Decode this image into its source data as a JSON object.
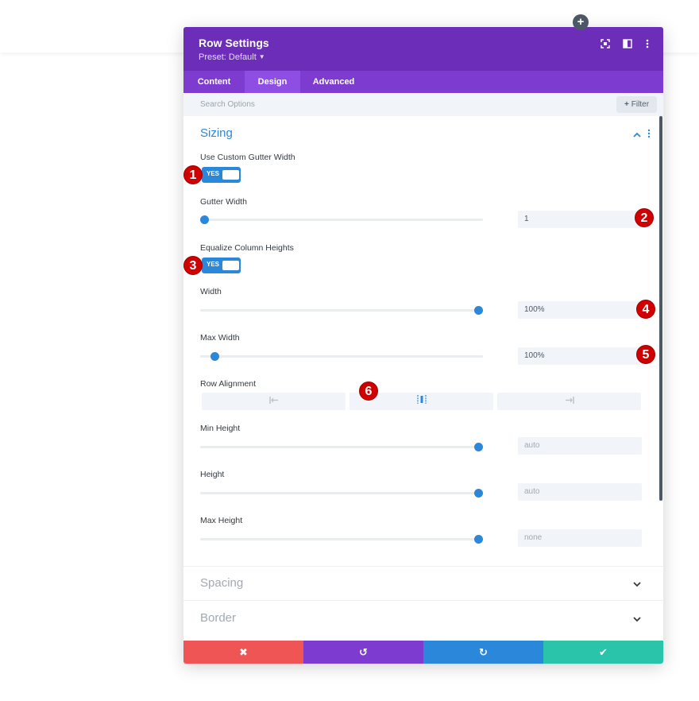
{
  "modal": {
    "title": "Row Settings",
    "preset": "Preset: Default",
    "header_icons": [
      "focus-icon",
      "sidebar-layout-icon",
      "kebab-menu-icon"
    ]
  },
  "tabs": [
    {
      "label": "Content",
      "active": false
    },
    {
      "label": "Design",
      "active": true
    },
    {
      "label": "Advanced",
      "active": false
    }
  ],
  "search": {
    "placeholder": "Search Options",
    "filter_label": "Filter"
  },
  "sections": {
    "sizing": {
      "title": "Sizing",
      "custom_gutter": {
        "label": "Use Custom Gutter Width",
        "toggle": "YES"
      },
      "gutter_width": {
        "label": "Gutter Width",
        "value": "1",
        "slider": 0.02
      },
      "equalize": {
        "label": "Equalize Column Heights",
        "toggle": "YES"
      },
      "width": {
        "label": "Width",
        "value": "100%",
        "slider": 1.0
      },
      "max_width": {
        "label": "Max Width",
        "value": "100%",
        "slider": 0.05
      },
      "row_alignment": {
        "label": "Row Alignment",
        "options": [
          "align-left-icon",
          "align-center-icon",
          "align-right-icon"
        ],
        "selected": "align-center-icon"
      },
      "min_height": {
        "label": "Min Height",
        "value": "auto",
        "slider": 1.0
      },
      "height": {
        "label": "Height",
        "value": "auto",
        "slider": 1.0
      },
      "max_height": {
        "label": "Max Height",
        "value": "none",
        "slider": 1.0
      }
    },
    "spacing": {
      "title": "Spacing"
    },
    "border": {
      "title": "Border"
    }
  },
  "footer": {
    "buttons": [
      {
        "name": "cancel",
        "glyph": "✖",
        "color": "#ef5555"
      },
      {
        "name": "undo",
        "glyph": "↺",
        "color": "#7e3bd0"
      },
      {
        "name": "redo",
        "glyph": "↻",
        "color": "#2b87da"
      },
      {
        "name": "save",
        "glyph": "✔",
        "color": "#29c4a9"
      }
    ]
  },
  "badges": [
    "1",
    "2",
    "3",
    "4",
    "5",
    "6"
  ],
  "colors": {
    "header": "#6c2eb9",
    "tabs": "#7e3bd0",
    "accent": "#2b87da",
    "badge": "#d00000"
  }
}
